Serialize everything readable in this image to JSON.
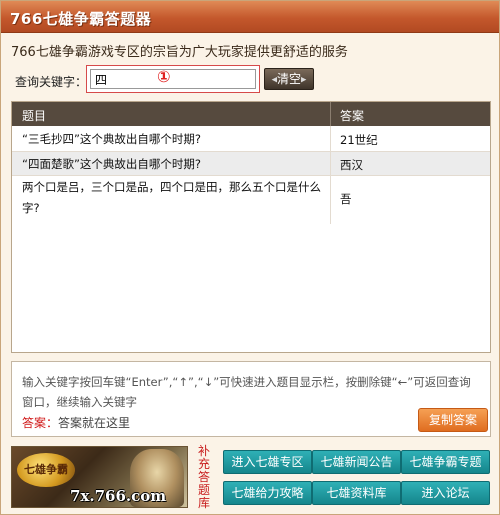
{
  "window": {
    "title": "766七雄争霸答题器"
  },
  "subtitle": "766七雄争霸游戏专区的宗旨为广大玩家提供更舒适的服务",
  "search": {
    "label": "查询关键字：",
    "value": "四",
    "marker": "①",
    "clear_label": "清空"
  },
  "results": {
    "headers": {
      "question": "题目",
      "answer": "答案"
    },
    "rows": [
      {
        "question": "“三毛抄四”这个典故出自哪个时期?",
        "answer": "21世纪"
      },
      {
        "question": "“四面楚歌”这个典故出自哪个时期?",
        "answer": "西汉"
      },
      {
        "question": "两个口是吕，三个口是品，四个口是田，那么五个口是什么字?",
        "answer": "吾"
      }
    ]
  },
  "help": {
    "text": "输入关键字按回车键“Enter”,“↑”,“↓”可快速进入题目显示栏，按删除键“←”可返回查询窗口，继续输入关键字",
    "answer_key": "答案：",
    "answer_value": "答案就在这里",
    "copy_label": "复制答案"
  },
  "footer": {
    "banner_site": "7x.766.com",
    "banner_logo": "七雄争霸",
    "side_label": "补充答题库",
    "links": [
      "进入七雄专区",
      "七雄新闻公告",
      "七雄争霸专题",
      "七雄给力攻略",
      "七雄资料库",
      "进入论坛"
    ]
  },
  "colors": {
    "title_bar": "#c4582c",
    "table_header": "#564a3e",
    "link_button": "#1fa0a6",
    "copy_button": "#e88235",
    "highlight": "#d01818"
  }
}
